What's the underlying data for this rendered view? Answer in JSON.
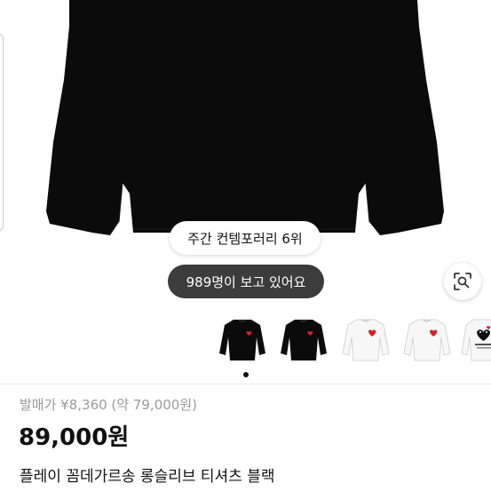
{
  "badges": {
    "weekly_rank": "주간 컨템포러리 6위",
    "viewers": "989명이 보고 있어요"
  },
  "thumbnails": [
    {
      "color": "black",
      "alt": "black-longsleeve"
    },
    {
      "color": "black",
      "alt": "black-longsleeve"
    },
    {
      "color": "white",
      "alt": "white-longsleeve"
    },
    {
      "color": "white",
      "alt": "white-longsleeve"
    },
    {
      "color": "white",
      "alt": "white-graphic-longsleeve"
    }
  ],
  "carousel": {
    "active_index": 0
  },
  "price": {
    "original": "발매가 ¥8,360 (약 79,000원)",
    "current": "89,000원"
  },
  "product": {
    "title": "플레이 꼼데가르송 롱슬리브 티셔츠 블랙"
  },
  "colors": {
    "shirt": "#0b0b0b",
    "heart": "#d0232b",
    "dark_badge": "#3c3c3c"
  }
}
